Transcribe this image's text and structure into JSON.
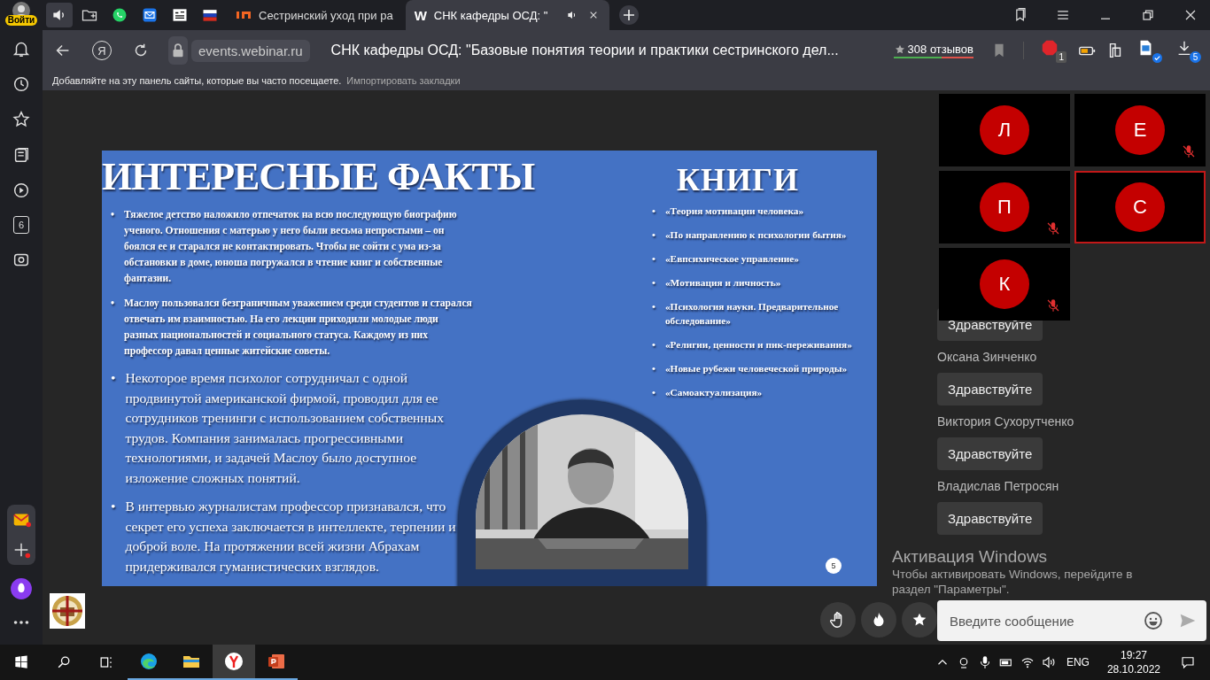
{
  "browser": {
    "profile": {
      "label": "Войти"
    },
    "pinned_tabs": [
      {
        "kind": "audio",
        "selected": true
      },
      {
        "kind": "folder",
        "selected": false
      },
      {
        "kind": "chat",
        "selected": false
      },
      {
        "kind": "mail",
        "selected": false
      },
      {
        "kind": "news",
        "selected": false
      },
      {
        "kind": "flag",
        "selected": false
      }
    ],
    "tabs": [
      {
        "title": "Сестринский уход при ра",
        "selected": false,
        "sound": false
      },
      {
        "icon_text": "W",
        "title": "СНК кафедры ОСД: \"",
        "selected": true,
        "sound": true
      }
    ],
    "yandex_button": "Я",
    "address": "events.webinar.ru",
    "page_title": "СНК кафедры ОСД: \"Базовые понятия теории и практики сестринского дел...",
    "reviews": "308 отзывов",
    "extension_badge": "1",
    "downloads_badge": "5",
    "bookmarks_hint": "Добавляйте на эту панель сайты, которые вы часто посещаете.",
    "import_link": "Импортировать закладки",
    "sidebar_badge": "6"
  },
  "slide": {
    "title": "ИНТЕРЕСНЫЕ ФАКТЫ",
    "bullet": "•",
    "facts": [
      {
        "text": "Тяжелое детство наложило отпечаток на всю последующую биографию ученого. Отношения с матерью у него были весьма непростыми – он боялся ее и старался не контактировать. Чтобы не сойти с ума из-за обстановки в доме, юноша погружался в чтение книг и собственные фантазии.",
        "large": false
      },
      {
        "text": "Маслоу пользовался безграничным уважением среди студентов и старался отвечать им взаимностью. На его лекции приходили молодые люди разных национальностей и социального статуса. Каждому из них профессор давал ценные житейские советы.",
        "large": false
      },
      {
        "text": "Некоторое время психолог сотрудничал с одной продвинутой американской фирмой, проводил для ее сотрудников тренинги с использованием собственных трудов. Компания занималась прогрессивными технологиями, и задачей Маслоу было доступное изложение сложных понятий.",
        "large": true
      },
      {
        "text": "В интервью журналистам профессор признавался, что секрет его успеха заключается в интеллекте, терпении и доброй воле. На протяжении всей жизни Абрахам придерживался гуманистических взглядов.",
        "large": true
      }
    ],
    "books_title": "КНИГИ",
    "books": [
      "«Теория мотивации человека»",
      "«По направлению к психологии бытия»",
      "«Евпсихическое управление»",
      "«Мотивация и личность»",
      "«Психология науки. Предварительное обследование»",
      "«Религии, ценности и пик-переживания»",
      "«Новые рубежи человеческой природы»",
      "«Самоактуализация»"
    ],
    "page_number": "5"
  },
  "video_tiles": [
    {
      "initial": "Л",
      "muted": false,
      "speaking": false
    },
    {
      "initial": "Е",
      "muted": true,
      "speaking": false
    },
    {
      "initial": "П",
      "muted": true,
      "speaking": false
    },
    {
      "initial": "С",
      "muted": false,
      "speaking": true
    },
    {
      "initial": "К",
      "muted": true,
      "speaking": false
    }
  ],
  "chat": {
    "messages": [
      {
        "text": "Здравствуйте"
      },
      {
        "author": "Оксана Зинченко",
        "text": "Здравствуйте"
      },
      {
        "author": "Виктория Сухорутченко",
        "text": "Здравствуйте"
      },
      {
        "author": "Владислав Петросян",
        "text": "Здравствуйте"
      }
    ],
    "placeholder": "Введите сообщение"
  },
  "reactions": [
    {
      "kind": "hand"
    },
    {
      "kind": "fire"
    },
    {
      "kind": "star"
    }
  ],
  "os_notice": {
    "title": "Активация Windows",
    "text": "Чтобы активировать Windows, перейдите в раздел \"Параметры\"."
  },
  "taskbar": {
    "apps": [
      {
        "kind": "edge",
        "selected": false
      },
      {
        "kind": "explorer",
        "selected": false
      },
      {
        "kind": "yandex",
        "selected": true
      },
      {
        "kind": "powerpoint",
        "selected": false
      }
    ],
    "language": "ENG",
    "time": "19:27",
    "date": "28.10.2022"
  }
}
